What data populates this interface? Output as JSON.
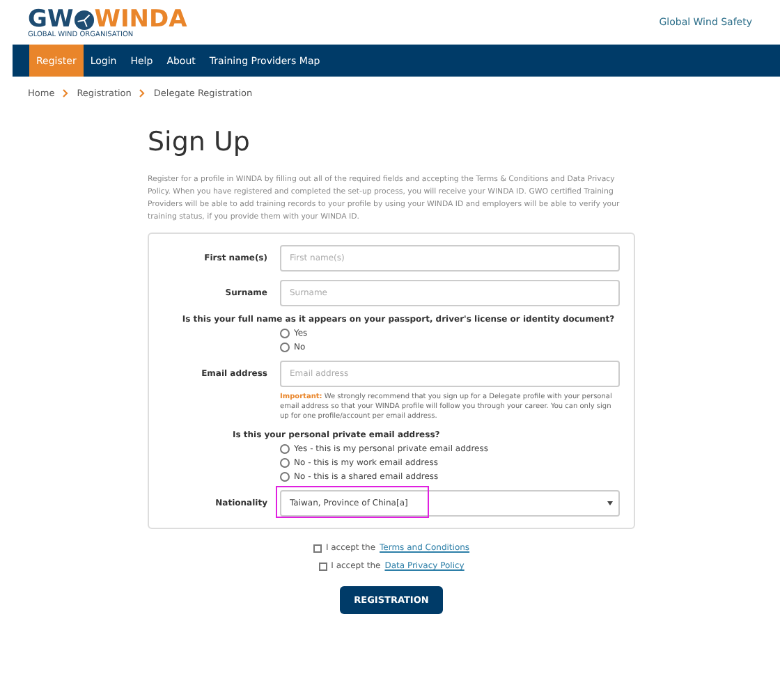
{
  "header": {
    "logo_left": "GW",
    "logo_right": "WINDA",
    "logo_tagline": "GLOBAL WIND ORGANISATION",
    "site_link": "Global Wind Safety"
  },
  "nav": [
    {
      "label": "Register",
      "selected": true
    },
    {
      "label": "Login",
      "selected": false
    },
    {
      "label": "Help",
      "selected": false
    },
    {
      "label": "About",
      "selected": false
    },
    {
      "label": "Training Providers Map",
      "selected": false
    }
  ],
  "breadcrumb": [
    "Home",
    "Registration",
    "Delegate Registration"
  ],
  "title": "Sign Up",
  "intro": "Register for a profile in WINDA by filling out all of the required fields and accepting the Terms & Conditions and Data Privacy Policy. When you have registered and completed the set-up process, you will receive your WINDA ID. GWO certified Training Providers will be able to add training records to your profile by using your WINDA ID and employers will be able to verify your training status, if you provide them with your WINDA ID.",
  "form": [
    {
      "kind": "text",
      "label": "First name(s)",
      "placeholder": "First name(s)"
    },
    {
      "kind": "text",
      "label": "Surname",
      "placeholder": "Surname"
    },
    {
      "kind": "radio",
      "question": "Is this your full name as it appears on your passport, driver's license or identity document?",
      "centered": true,
      "options": [
        {
          "label": "Yes",
          "selected": false
        },
        {
          "label": "No",
          "selected": false
        }
      ]
    },
    {
      "kind": "text",
      "label": "Email address",
      "placeholder": "Email address",
      "note_lead": "Important:",
      "note": "We strongly recommend that you sign up for a Delegate profile with your personal email address so that your WINDA profile will follow you through your career. You can only sign up for one profile/account per email address."
    },
    {
      "kind": "radio",
      "question": "Is this your personal private email address?",
      "centered": false,
      "options": [
        {
          "label": "Yes - this is my personal private email address",
          "selected": false
        },
        {
          "label": "No - this is my work email address",
          "selected": false
        },
        {
          "label": "No - this is a shared email address",
          "selected": false
        }
      ]
    },
    {
      "kind": "select",
      "label": "Nationality",
      "value": "Taiwan, Province of China[a]",
      "highlighted": true
    }
  ],
  "agreements": [
    {
      "prefix": "I accept the",
      "link": "Terms and Conditions",
      "checked": false
    },
    {
      "prefix": "I accept the",
      "link": "Data Privacy Policy",
      "checked": false
    }
  ],
  "submit": "REGISTRATION"
}
